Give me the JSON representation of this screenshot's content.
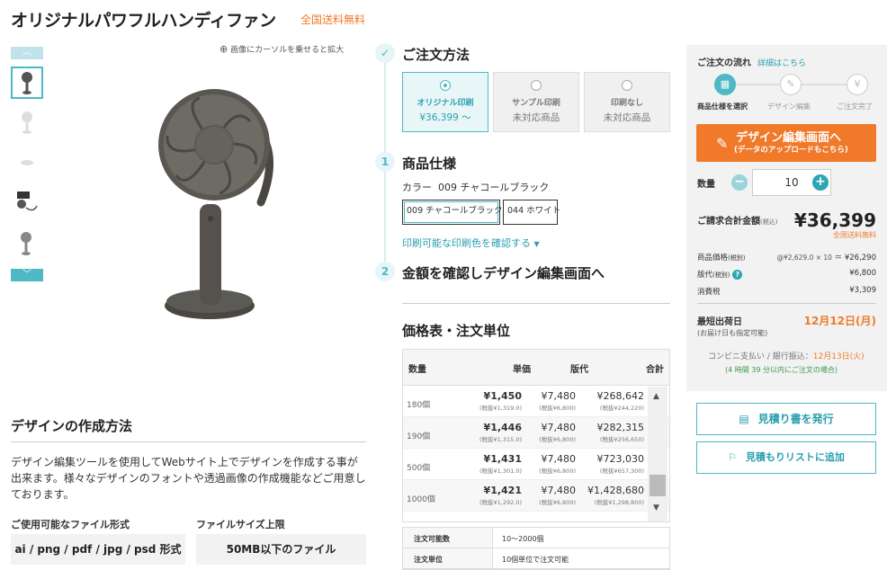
{
  "product": {
    "title": "オリジナルパワフルハンディファン",
    "free_shipping": "全国送料無料",
    "zoom_hint": "画像にカーソルを乗せると拡大"
  },
  "design_method": {
    "heading": "デザインの作成方法",
    "body": "デザイン編集ツールを使用してWebサイト上でデザインを作成する事が出来ます。様々なデザインのフォントや透過画像の作成機能などご用意しております。",
    "file_formats_label": "ご使用可能なファイル形式",
    "file_formats": "ai / png / pdf / jpg / psd 形式",
    "file_size_label": "ファイルサイズ上限",
    "file_size": "50MB以下のファイル"
  },
  "order": {
    "heading": "ご注文方法",
    "options": [
      {
        "label": "オリジナル印刷",
        "price": "¥36,399 ～",
        "selected": true
      },
      {
        "label": "サンプル印刷",
        "price": "未対応商品",
        "selected": false
      },
      {
        "label": "印刷なし",
        "price": "未対応商品",
        "selected": false
      }
    ],
    "step1_num": "1",
    "step1_title": "商品仕様",
    "color_label": "カラー",
    "color_value": "009 チャコールブラック",
    "colors": [
      "009 チャコールブラック",
      "044 ホワイト"
    ],
    "print_color_link": "印刷可能な印刷色を確認する",
    "step2_num": "2",
    "step2_title": "金額を確認しデザイン編集画面へ"
  },
  "price_table": {
    "heading": "価格表・注文単位",
    "columns": [
      "数量",
      "単価",
      "版代",
      "合計"
    ],
    "rows": [
      {
        "qty": "180個",
        "unit": "¥1,450",
        "unit_tax": "(税抜¥1,319.0)",
        "plate": "¥7,480",
        "plate_tax": "(税抜¥6,800)",
        "total": "¥268,642",
        "total_tax": "(税抜¥244,220)"
      },
      {
        "qty": "190個",
        "unit": "¥1,446",
        "unit_tax": "(税抜¥1,315.0)",
        "plate": "¥7,480",
        "plate_tax": "(税抜¥6,800)",
        "total": "¥282,315",
        "total_tax": "(税抜¥256,650)"
      },
      {
        "qty": "500個",
        "unit": "¥1,431",
        "unit_tax": "(税抜¥1,301.0)",
        "plate": "¥7,480",
        "plate_tax": "(税抜¥6,800)",
        "total": "¥723,030",
        "total_tax": "(税抜¥657,300)"
      },
      {
        "qty": "1000個",
        "unit": "¥1,421",
        "unit_tax": "(税抜¥1,292.0)",
        "plate": "¥7,480",
        "plate_tax": "(税抜¥6,800)",
        "total": "¥1,428,680",
        "total_tax": "(税抜¥1,298,800)"
      }
    ],
    "spec": [
      {
        "key": "注文可能数",
        "value": "10～2000個"
      },
      {
        "key": "注文単位",
        "value": "10個単位で注文可能"
      }
    ]
  },
  "sidebar": {
    "flow_title": "ご注文の流れ",
    "flow_link": "詳細はこちら",
    "flow_steps": [
      "商品仕様を選択",
      "デザイン編集",
      "ご注文完了"
    ],
    "design_btn_main": "デザイン編集画面へ",
    "design_btn_sub": "(データのアップロードもこちら)",
    "qty_label": "数量",
    "qty_value": "10",
    "total_label": "ご請求合計金額",
    "total_tax_note": "(税込)",
    "total_value": "¥36,399",
    "total_free_ship": "全国送料無料",
    "item_price_label": "商品価格",
    "item_price_tax": "(税別)",
    "item_price_calc": "@¥2,629.0 × 10",
    "item_price_value": "¥26,290",
    "plate_label": "版代",
    "plate_tax": "(税別)",
    "plate_value": "¥6,800",
    "tax_label": "消費税",
    "tax_value": "¥3,309",
    "ship_label": "最短出荷日",
    "ship_sub": "(お届け日も指定可能)",
    "ship_date": "12月12日(月)",
    "conv_note": "コンビニ支払い / 銀行振込：",
    "conv_date": "12月13日(火)",
    "deadline_note": "(4 時間 39 分以内にご注文の場合)",
    "quote_btn": "見積り書を発行",
    "list_btn": "見積もりリストに追加"
  }
}
